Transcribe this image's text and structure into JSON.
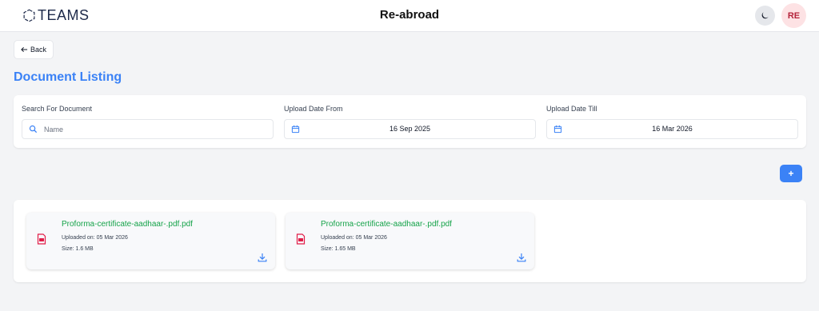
{
  "header": {
    "logo_text": "TEAMS",
    "title": "Re-abroad",
    "theme_icon": "moon-icon",
    "avatar_initials": "RE"
  },
  "nav": {
    "back_label": "Back",
    "back_icon": "arrow-left-icon"
  },
  "page": {
    "title": "Document Listing"
  },
  "filters": {
    "search": {
      "label": "Search For Document",
      "placeholder": "Name",
      "value": "",
      "icon": "search-icon"
    },
    "date_from": {
      "label": "Upload Date From",
      "value": "16 Sep 2025",
      "icon": "calendar-icon"
    },
    "date_till": {
      "label": "Upload Date Till",
      "value": "16 Mar 2026",
      "icon": "calendar-icon"
    }
  },
  "actions": {
    "add_label": "+"
  },
  "documents": [
    {
      "name": "Proforma-certificate-aadhaar-.pdf.pdf",
      "uploaded": "Uploaded on: 05 Mar 2026",
      "size": "Size: 1.6 MB",
      "icon": "pdf-file-icon",
      "download_icon": "download-icon"
    },
    {
      "name": "Proforma-certificate-aadhaar-.pdf.pdf",
      "uploaded": "Uploaded on: 05 Mar 2026",
      "size": "Size: 1.65 MB",
      "icon": "pdf-file-icon",
      "download_icon": "download-icon"
    }
  ],
  "colors": {
    "accent": "#3b82f6",
    "doc_name": "#16a34a",
    "pdf_icon": "#e11d48",
    "avatar_bg": "#fde2e4",
    "avatar_text": "#b4233a"
  }
}
